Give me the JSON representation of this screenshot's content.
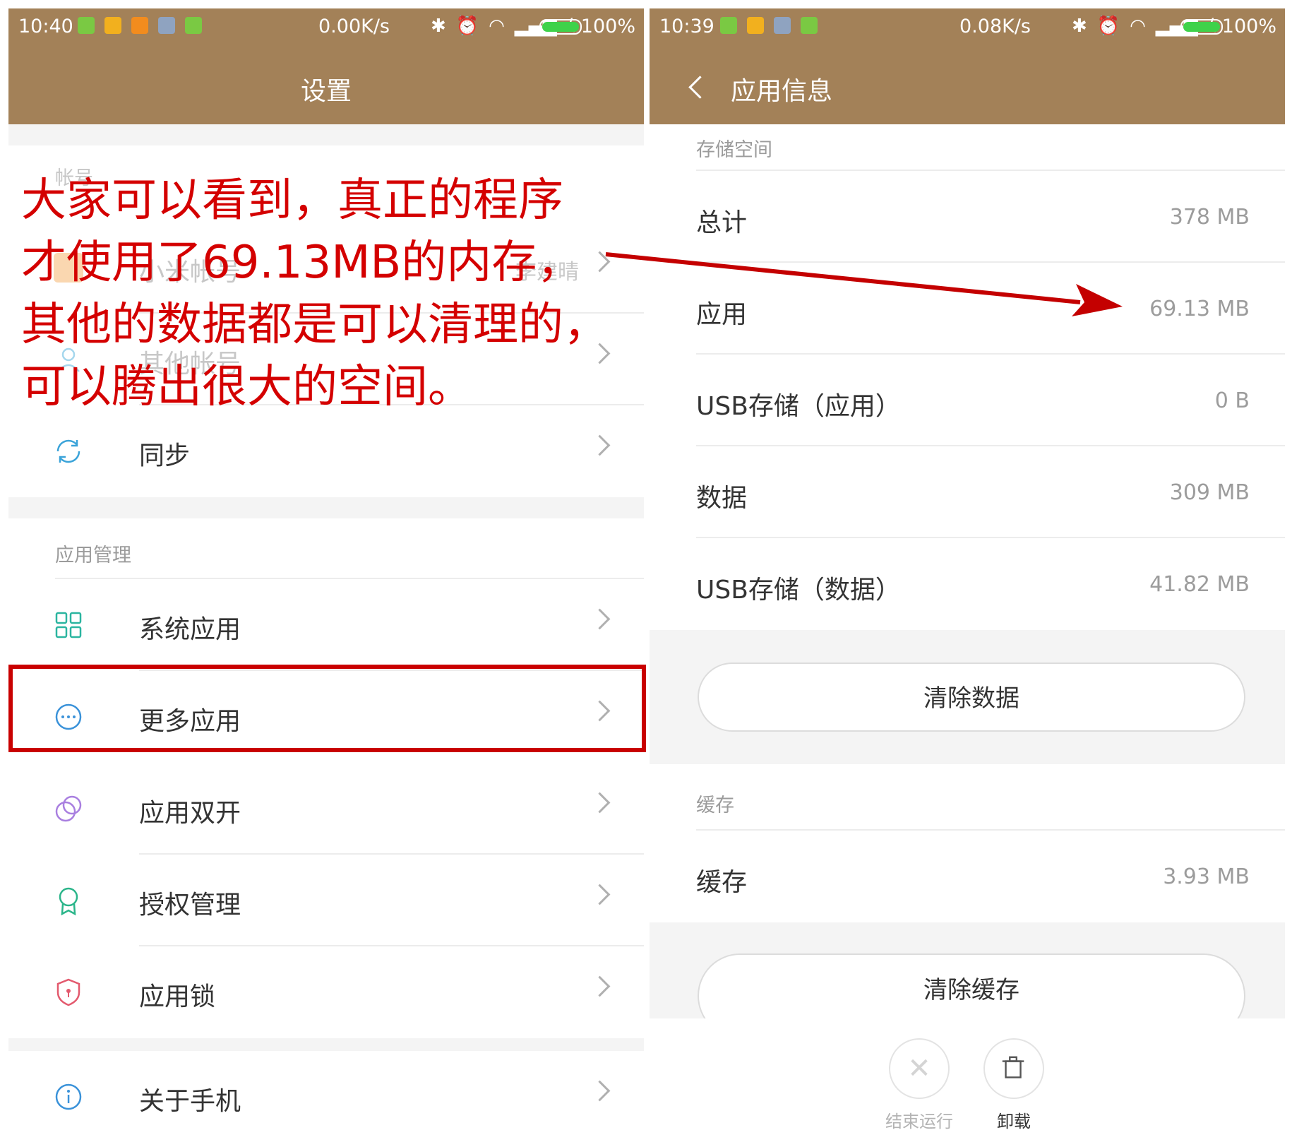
{
  "left": {
    "status": {
      "time": "10:40",
      "speed": "0.00K/s",
      "battery": "100%"
    },
    "title": "设置",
    "account_section_label": "帐号",
    "account_items": [
      {
        "label": "小米帐号",
        "value": "李建晴"
      },
      {
        "label": "其他帐号"
      },
      {
        "label": "同步"
      }
    ],
    "apps_section_label": "应用管理",
    "apps_items": [
      {
        "label": "系统应用",
        "icon": "grid-icon"
      },
      {
        "label": "更多应用",
        "icon": "more-circle-icon"
      },
      {
        "label": "应用双开",
        "icon": "dual-circle-icon"
      },
      {
        "label": "授权管理",
        "icon": "badge-icon"
      },
      {
        "label": "应用锁",
        "icon": "shield-icon"
      }
    ],
    "about": {
      "label": "关于手机",
      "icon": "info-icon"
    }
  },
  "annotation": {
    "lines": [
      "大家可以看到，真正的程序",
      "才使用了69.13MB的内存，",
      "其他的数据都是可以清理的，",
      "可以腾出很大的空间。"
    ],
    "color": "#d40000"
  },
  "right": {
    "status": {
      "time": "10:39",
      "speed": "0.08K/s",
      "battery": "100%"
    },
    "title": "应用信息",
    "storage_section_label": "存储空间",
    "storage_items": [
      {
        "label": "总计",
        "value": "378 MB"
      },
      {
        "label": "应用",
        "value": "69.13 MB"
      },
      {
        "label": "USB存储（应用）",
        "value": "0 B"
      },
      {
        "label": "数据",
        "value": "309 MB"
      },
      {
        "label": "USB存储（数据）",
        "value": "41.82 MB"
      }
    ],
    "clear_data_label": "清除数据",
    "cache_section_label": "缓存",
    "cache_item": {
      "label": "缓存",
      "value": "3.93 MB"
    },
    "clear_cache_label": "清除缓存",
    "bottom": {
      "force_stop_label": "结束运行",
      "uninstall_label": "卸载"
    }
  },
  "colors": {
    "toolbar": "#a38158",
    "annotation": "#d40000",
    "battery": "#3fd24a"
  }
}
